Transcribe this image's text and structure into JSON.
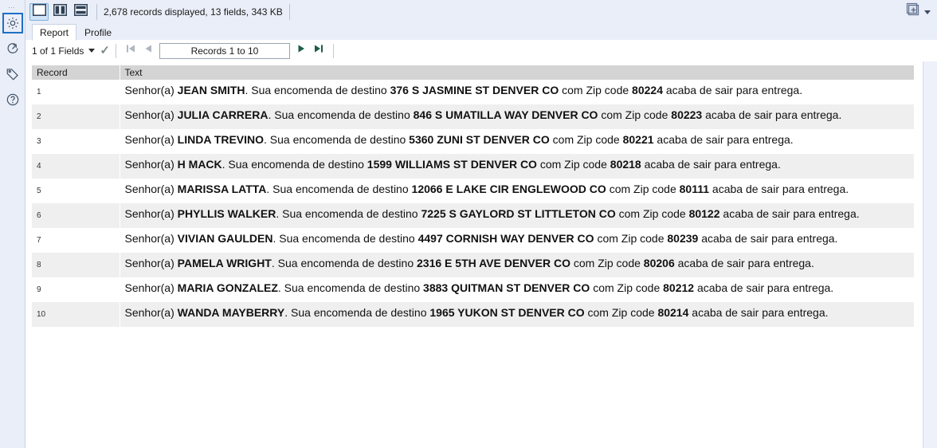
{
  "rail": {
    "grip": "⋯",
    "items": [
      {
        "name": "gear-icon",
        "label": "Configuration",
        "selected": true
      },
      {
        "name": "share-icon",
        "label": "Output",
        "selected": false
      },
      {
        "name": "tag-icon",
        "label": "Annotation",
        "selected": false
      },
      {
        "name": "help-icon",
        "label": "Help",
        "selected": false
      }
    ]
  },
  "toolbar": {
    "layout_buttons": [
      {
        "name": "layout-single-pane",
        "selected": true
      },
      {
        "name": "layout-vertical-split",
        "selected": false
      },
      {
        "name": "layout-horizontal-split",
        "selected": false
      }
    ],
    "records_info": "2,678 records displayed, 13 fields, 343 KB",
    "add_panel_label": "+",
    "add_panel_name": "add-panel-button"
  },
  "tabs": [
    {
      "label": "Report",
      "active": true
    },
    {
      "label": "Profile",
      "active": false
    }
  ],
  "nav": {
    "fields_selector": "1 of 1 Fields",
    "check_glyph": "✓",
    "first_label": "First record",
    "prev_label": "Previous record",
    "records_range": "Records 1 to 10",
    "next_label": "Next record",
    "last_label": "Last record"
  },
  "table": {
    "columns": [
      "Record",
      "Text"
    ],
    "rows": [
      {
        "record": "1",
        "parts": [
          {
            "t": "Senhor(a) ",
            "b": false
          },
          {
            "t": "JEAN SMITH",
            "b": true
          },
          {
            "t": ". Sua encomenda de destino ",
            "b": false
          },
          {
            "t": "376 S JASMINE ST DENVER CO",
            "b": true
          },
          {
            "t": " com Zip code ",
            "b": false
          },
          {
            "t": "80224",
            "b": true
          },
          {
            "t": " acaba de sair para entrega.",
            "b": false
          }
        ]
      },
      {
        "record": "2",
        "parts": [
          {
            "t": "Senhor(a) ",
            "b": false
          },
          {
            "t": "JULIA CARRERA",
            "b": true
          },
          {
            "t": ". Sua encomenda de destino ",
            "b": false
          },
          {
            "t": "846 S UMATILLA WAY DENVER CO",
            "b": true
          },
          {
            "t": " com Zip code ",
            "b": false
          },
          {
            "t": "80223",
            "b": true
          },
          {
            "t": " acaba de sair para entrega.",
            "b": false
          }
        ]
      },
      {
        "record": "3",
        "parts": [
          {
            "t": "Senhor(a) ",
            "b": false
          },
          {
            "t": "LINDA TREVINO",
            "b": true
          },
          {
            "t": ". Sua encomenda de destino ",
            "b": false
          },
          {
            "t": "5360 ZUNI ST DENVER CO",
            "b": true
          },
          {
            "t": " com Zip code ",
            "b": false
          },
          {
            "t": "80221",
            "b": true
          },
          {
            "t": " acaba de sair para entrega.",
            "b": false
          }
        ]
      },
      {
        "record": "4",
        "parts": [
          {
            "t": "Senhor(a) ",
            "b": false
          },
          {
            "t": "H MACK",
            "b": true
          },
          {
            "t": ". Sua encomenda de destino ",
            "b": false
          },
          {
            "t": "1599 WILLIAMS ST DENVER CO",
            "b": true
          },
          {
            "t": " com Zip code ",
            "b": false
          },
          {
            "t": "80218",
            "b": true
          },
          {
            "t": " acaba de sair para entrega.",
            "b": false
          }
        ]
      },
      {
        "record": "5",
        "parts": [
          {
            "t": "Senhor(a) ",
            "b": false
          },
          {
            "t": "MARISSA LATTA",
            "b": true
          },
          {
            "t": ". Sua encomenda de destino ",
            "b": false
          },
          {
            "t": "12066 E LAKE CIR ENGLEWOOD CO",
            "b": true
          },
          {
            "t": " com Zip code ",
            "b": false
          },
          {
            "t": "80111",
            "b": true
          },
          {
            "t": " acaba de sair para entrega.",
            "b": false
          }
        ]
      },
      {
        "record": "6",
        "parts": [
          {
            "t": "Senhor(a) ",
            "b": false
          },
          {
            "t": "PHYLLIS WALKER",
            "b": true
          },
          {
            "t": ". Sua encomenda de destino ",
            "b": false
          },
          {
            "t": "7225 S GAYLORD ST LITTLETON CO",
            "b": true
          },
          {
            "t": " com Zip code ",
            "b": false
          },
          {
            "t": "80122",
            "b": true
          },
          {
            "t": " acaba de sair para entrega.",
            "b": false
          }
        ]
      },
      {
        "record": "7",
        "parts": [
          {
            "t": "Senhor(a) ",
            "b": false
          },
          {
            "t": "VIVIAN GAULDEN",
            "b": true
          },
          {
            "t": ". Sua encomenda de destino ",
            "b": false
          },
          {
            "t": "4497 CORNISH WAY DENVER CO",
            "b": true
          },
          {
            "t": " com Zip code ",
            "b": false
          },
          {
            "t": "80239",
            "b": true
          },
          {
            "t": " acaba de sair para entrega.",
            "b": false
          }
        ]
      },
      {
        "record": "8",
        "parts": [
          {
            "t": "Senhor(a) ",
            "b": false
          },
          {
            "t": "PAMELA WRIGHT",
            "b": true
          },
          {
            "t": ". Sua encomenda de destino ",
            "b": false
          },
          {
            "t": "2316 E 5TH AVE DENVER CO",
            "b": true
          },
          {
            "t": " com Zip code ",
            "b": false
          },
          {
            "t": "80206",
            "b": true
          },
          {
            "t": " acaba de sair para entrega.",
            "b": false
          }
        ]
      },
      {
        "record": "9",
        "parts": [
          {
            "t": "Senhor(a) ",
            "b": false
          },
          {
            "t": "MARIA GONZALEZ",
            "b": true
          },
          {
            "t": ". Sua encomenda de destino ",
            "b": false
          },
          {
            "t": "3883 QUITMAN ST DENVER CO",
            "b": true
          },
          {
            "t": " com Zip code ",
            "b": false
          },
          {
            "t": "80212",
            "b": true
          },
          {
            "t": " acaba de sair para entrega.",
            "b": false
          }
        ]
      },
      {
        "record": "10",
        "parts": [
          {
            "t": "Senhor(a) ",
            "b": false
          },
          {
            "t": "WANDA MAYBERRY",
            "b": true
          },
          {
            "t": ". Sua encomenda de destino ",
            "b": false
          },
          {
            "t": "1965 YUKON ST DENVER CO",
            "b": true
          },
          {
            "t": " com Zip code ",
            "b": false
          },
          {
            "t": "80214",
            "b": true
          },
          {
            "t": " acaba de sair para entrega.",
            "b": false
          }
        ]
      }
    ]
  },
  "colors": {
    "chrome": "#eaeef8",
    "accent_selected": "#1f6fc4",
    "header_row": "#d4d4d4",
    "alt_row": "#efefef",
    "nav_active": "#1d5c4a"
  }
}
